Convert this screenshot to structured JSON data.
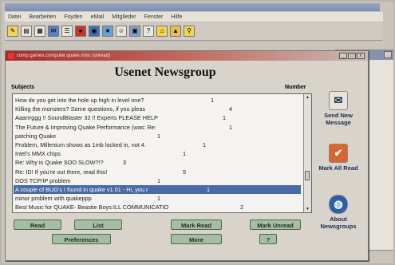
{
  "menu": [
    "Datei",
    "Bearbeiten",
    "Foyden",
    "eMail",
    "Mitglieder",
    "Fenster",
    "Hilfe"
  ],
  "toolbar_icons": [
    "new-icon",
    "open-icon",
    "print-icon",
    "mail-icon",
    "news-icon",
    "chat-icon",
    "web-icon",
    "favorites-icon",
    "people-icon",
    "calendar-icon",
    "help-icon",
    "home-icon",
    "gallery-icon",
    "search-icon"
  ],
  "window": {
    "title": "comp.games.computer.quake.misc (unread)",
    "minimize": "_",
    "maximize": "□",
    "close": "x"
  },
  "heading": "Usenet Newsgroup",
  "columns": {
    "subjects": "Subjects",
    "number": "Number"
  },
  "threads": [
    {
      "subject": "How do you get into the hole up high in level one?",
      "number": "1"
    },
    {
      "subject": "Killing the monsters? Some questions, if you pleas",
      "number": "4"
    },
    {
      "subject": "Aaarrrggg !! SoundBlaster 32 !! Experts PLEASE HELP",
      "number": "1"
    },
    {
      "subject": "The Future & Improving Quake Performance (was: Re:",
      "number": "1"
    },
    {
      "subject": "patching Quake",
      "number": "1"
    },
    {
      "subject": "Problem, Millenium shows as 1mb locked in, not 4.",
      "number": "1"
    },
    {
      "subject": "Intel's MMX chips",
      "number": "1"
    },
    {
      "subject": "Re: Why is Quake SOO SLOW?!?",
      "number": "3"
    },
    {
      "subject": "Re: ID! If you're out there, read this!",
      "number": "5"
    },
    {
      "subject": "DOS TCP/IP problem",
      "number": "1"
    },
    {
      "subject": "A couple of BUG's I found in quake v1.01 - Hi, you r",
      "number": "1"
    },
    {
      "subject": "minor problem with quakeppp",
      "number": "1"
    },
    {
      "subject": "Best Music for QUAKE- Beastie Boys:ILL COMMUNICATIO",
      "number": "2"
    }
  ],
  "selected_index": 10,
  "buttons": {
    "read": "Read",
    "list": "List",
    "mark_read": "Mark Read",
    "mark_unread": "Mark Unread",
    "preferences": "Preferences",
    "more": "More",
    "help": "?"
  },
  "side_actions": [
    {
      "label": "Send New Message",
      "icon": "send-message-icon"
    },
    {
      "label": "Mark All Read",
      "icon": "mark-all-read-icon"
    },
    {
      "label": "About Newsgroups",
      "icon": "globe-icon"
    }
  ],
  "colors": {
    "title_bar": "#a52b2b",
    "selection": "#4969a8",
    "button": "#a5bda3"
  }
}
